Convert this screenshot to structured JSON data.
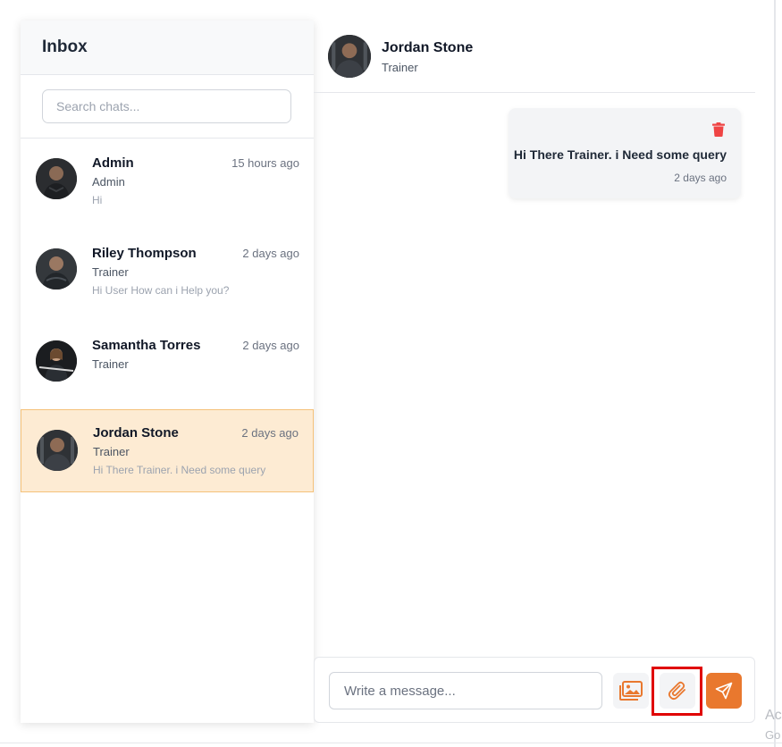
{
  "sidebar": {
    "title": "Inbox",
    "search_placeholder": "Search chats...",
    "chats": [
      {
        "name": "Admin",
        "time": "15 hours ago",
        "role": "Admin",
        "preview": "Hi",
        "active": false
      },
      {
        "name": "Riley Thompson",
        "time": "2 days ago",
        "role": "Trainer",
        "preview": "Hi User How can i Help you?",
        "active": false
      },
      {
        "name": "Samantha Torres",
        "time": "2 days ago",
        "role": "Trainer",
        "preview": "",
        "active": false
      },
      {
        "name": "Jordan Stone",
        "time": "2 days ago",
        "role": "Trainer",
        "preview": "Hi There Trainer. i Need some query",
        "active": true
      }
    ]
  },
  "chat": {
    "header": {
      "name": "Jordan Stone",
      "role": "Trainer"
    },
    "messages": [
      {
        "text": "Hi There Trainer. i Need some query",
        "time": "2 days ago"
      }
    ],
    "composer": {
      "placeholder": "Write a message...",
      "image_icon": "image-icon",
      "attach_icon": "paperclip-icon",
      "send_icon": "send-icon"
    }
  },
  "watermark": {
    "line1": "Ac",
    "line2": "Go"
  },
  "colors": {
    "accent": "#e9782e",
    "active_row": "#fdebd3",
    "active_border": "#f5c27a",
    "delete": "#ef4444",
    "highlight": "#e00000"
  }
}
